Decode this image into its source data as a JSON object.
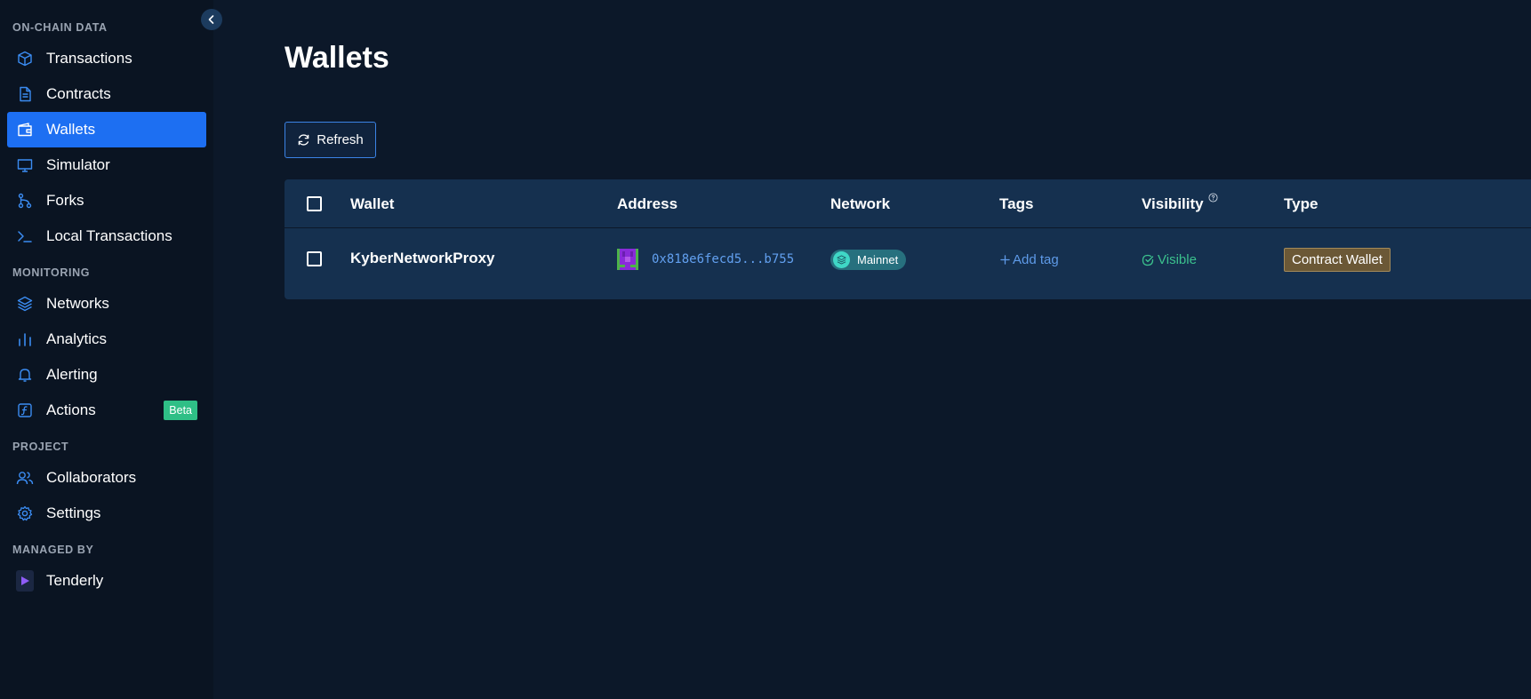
{
  "sidebar": {
    "sections": {
      "onchain": "ON-CHAIN DATA",
      "monitoring": "MONITORING",
      "project": "PROJECT",
      "managed_by": "MANAGED BY"
    },
    "items": {
      "transactions": "Transactions",
      "contracts": "Contracts",
      "wallets": "Wallets",
      "simulator": "Simulator",
      "forks": "Forks",
      "local_transactions": "Local Transactions",
      "networks": "Networks",
      "analytics": "Analytics",
      "alerting": "Alerting",
      "actions": "Actions",
      "collaborators": "Collaborators",
      "settings": "Settings",
      "tenderly": "Tenderly"
    },
    "actions_badge": "Beta",
    "active_item": "wallets"
  },
  "page": {
    "title": "Wallets",
    "refresh_label": "Refresh"
  },
  "table": {
    "columns": {
      "wallet": "Wallet",
      "address": "Address",
      "network": "Network",
      "tags": "Tags",
      "visibility": "Visibility",
      "type": "Type"
    },
    "rows": [
      {
        "wallet": "KyberNetworkProxy",
        "address": "0x818e6fecd5...b755",
        "network": "Mainnet",
        "tags_action": "Add tag",
        "visibility": "Visible",
        "type": "Contract Wallet"
      }
    ]
  },
  "colors": {
    "background": "#0c1829",
    "sidebar": "#0a1422",
    "accent": "#1d6ff2",
    "table_bg": "#15304f",
    "visible_green": "#3bc18d",
    "beta_badge": "#2fbf86",
    "link_blue": "#62a0f0"
  }
}
